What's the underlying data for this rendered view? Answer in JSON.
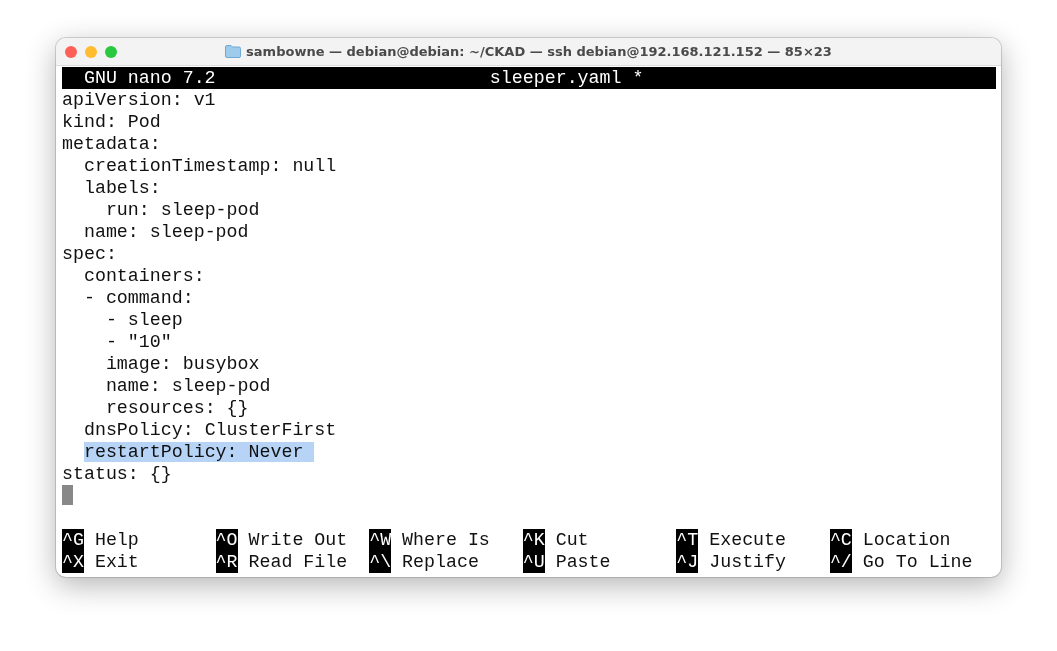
{
  "window": {
    "title": "sambowne — debian@debian: ~/CKAD — ssh debian@192.168.121.152 — 85×23"
  },
  "header": {
    "app": "GNU nano 7.2",
    "filename": "sleeper.yaml *"
  },
  "lines": [
    {
      "text": "apiVersion: v1",
      "selected": false
    },
    {
      "text": "kind: Pod",
      "selected": false
    },
    {
      "text": "metadata:",
      "selected": false
    },
    {
      "text": "  creationTimestamp: null",
      "selected": false
    },
    {
      "text": "  labels:",
      "selected": false
    },
    {
      "text": "    run: sleep-pod",
      "selected": false
    },
    {
      "text": "  name: sleep-pod",
      "selected": false
    },
    {
      "text": "spec:",
      "selected": false
    },
    {
      "text": "  containers:",
      "selected": false
    },
    {
      "text": "  - command:",
      "selected": false
    },
    {
      "text": "    - sleep",
      "selected": false
    },
    {
      "text": "    - \"10\"",
      "selected": false
    },
    {
      "text": "    image: busybox",
      "selected": false
    },
    {
      "text": "    name: sleep-pod",
      "selected": false
    },
    {
      "text": "    resources: {}",
      "selected": false
    },
    {
      "text": "  dnsPolicy: ClusterFirst",
      "selected": false
    },
    {
      "text": "  restartPolicy: Never",
      "selected": true
    },
    {
      "text": "status: {}",
      "selected": false
    }
  ],
  "shortcuts": [
    {
      "key": "^G",
      "label": "Help"
    },
    {
      "key": "^X",
      "label": "Exit"
    },
    {
      "key": "^O",
      "label": "Write Out"
    },
    {
      "key": "^R",
      "label": "Read File"
    },
    {
      "key": "^W",
      "label": "Where Is"
    },
    {
      "key": "^\\",
      "label": "Replace"
    },
    {
      "key": "^K",
      "label": "Cut"
    },
    {
      "key": "^U",
      "label": "Paste"
    },
    {
      "key": "^T",
      "label": "Execute"
    },
    {
      "key": "^J",
      "label": "Justify"
    },
    {
      "key": "^C",
      "label": "Location"
    },
    {
      "key": "^/",
      "label": "Go To Line"
    }
  ]
}
